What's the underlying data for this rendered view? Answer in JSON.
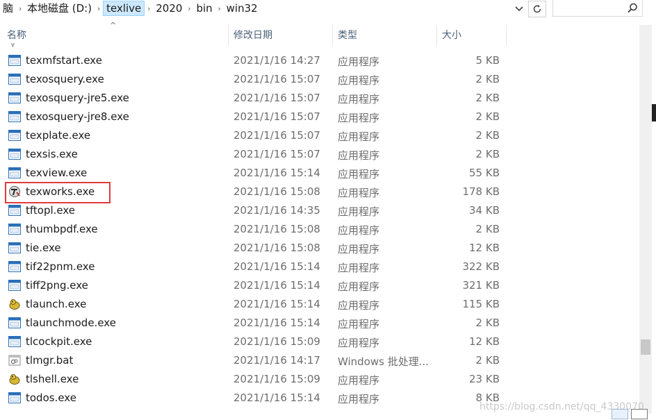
{
  "address": {
    "crumbs": [
      "脑",
      "本地磁盘 (D:)",
      "texlive",
      "2020",
      "bin",
      "win32"
    ],
    "active_crumb": "texlive",
    "dropdown_icon": "chevron-down-icon",
    "refresh_icon": "refresh-icon"
  },
  "search": {
    "placeholder": "",
    "icon": "search-icon"
  },
  "columns": {
    "name": "名称",
    "date": "修改日期",
    "type": "类型",
    "size": "大小"
  },
  "files": [
    {
      "name": "texmfstart.exe",
      "date": "2021/1/16 14:27",
      "type": "应用程序",
      "size": "5 KB",
      "icon": "exe"
    },
    {
      "name": "texosquery.exe",
      "date": "2021/1/16 15:07",
      "type": "应用程序",
      "size": "2 KB",
      "icon": "exe"
    },
    {
      "name": "texosquery-jre5.exe",
      "date": "2021/1/16 15:07",
      "type": "应用程序",
      "size": "2 KB",
      "icon": "exe"
    },
    {
      "name": "texosquery-jre8.exe",
      "date": "2021/1/16 15:07",
      "type": "应用程序",
      "size": "2 KB",
      "icon": "exe"
    },
    {
      "name": "texplate.exe",
      "date": "2021/1/16 15:07",
      "type": "应用程序",
      "size": "2 KB",
      "icon": "exe"
    },
    {
      "name": "texsis.exe",
      "date": "2021/1/16 15:07",
      "type": "应用程序",
      "size": "2 KB",
      "icon": "exe"
    },
    {
      "name": "texview.exe",
      "date": "2021/1/16 15:14",
      "type": "应用程序",
      "size": "55 KB",
      "icon": "exe"
    },
    {
      "name": "texworks.exe",
      "date": "2021/1/16 15:08",
      "type": "应用程序",
      "size": "178 KB",
      "icon": "texworks"
    },
    {
      "name": "tftopl.exe",
      "date": "2021/1/16 14:35",
      "type": "应用程序",
      "size": "34 KB",
      "icon": "exe"
    },
    {
      "name": "thumbpdf.exe",
      "date": "2021/1/16 15:08",
      "type": "应用程序",
      "size": "2 KB",
      "icon": "exe"
    },
    {
      "name": "tie.exe",
      "date": "2021/1/16 15:08",
      "type": "应用程序",
      "size": "12 KB",
      "icon": "exe"
    },
    {
      "name": "tif22pnm.exe",
      "date": "2021/1/16 15:14",
      "type": "应用程序",
      "size": "322 KB",
      "icon": "exe"
    },
    {
      "name": "tiff2png.exe",
      "date": "2021/1/16 15:14",
      "type": "应用程序",
      "size": "321 KB",
      "icon": "exe"
    },
    {
      "name": "tlaunch.exe",
      "date": "2021/1/16 15:14",
      "type": "应用程序",
      "size": "115 KB",
      "icon": "duck"
    },
    {
      "name": "tlaunchmode.exe",
      "date": "2021/1/16 15:14",
      "type": "应用程序",
      "size": "2 KB",
      "icon": "exe"
    },
    {
      "name": "tlcockpit.exe",
      "date": "2021/1/16 15:09",
      "type": "应用程序",
      "size": "12 KB",
      "icon": "exe"
    },
    {
      "name": "tlmgr.bat",
      "date": "2021/1/16 14:17",
      "type": "Windows 批处理...",
      "size": "2 KB",
      "icon": "bat"
    },
    {
      "name": "tlshell.exe",
      "date": "2021/1/16 15:09",
      "type": "应用程序",
      "size": "23 KB",
      "icon": "duck"
    },
    {
      "name": "todos.exe",
      "date": "2021/1/16 15:14",
      "type": "应用程序",
      "size": "8 KB",
      "icon": "exe"
    }
  ],
  "highlighted_file": "texworks.exe",
  "highlight_color": "#e03a3a",
  "watermark": "https://blog.csdn.net/qq_4330070"
}
